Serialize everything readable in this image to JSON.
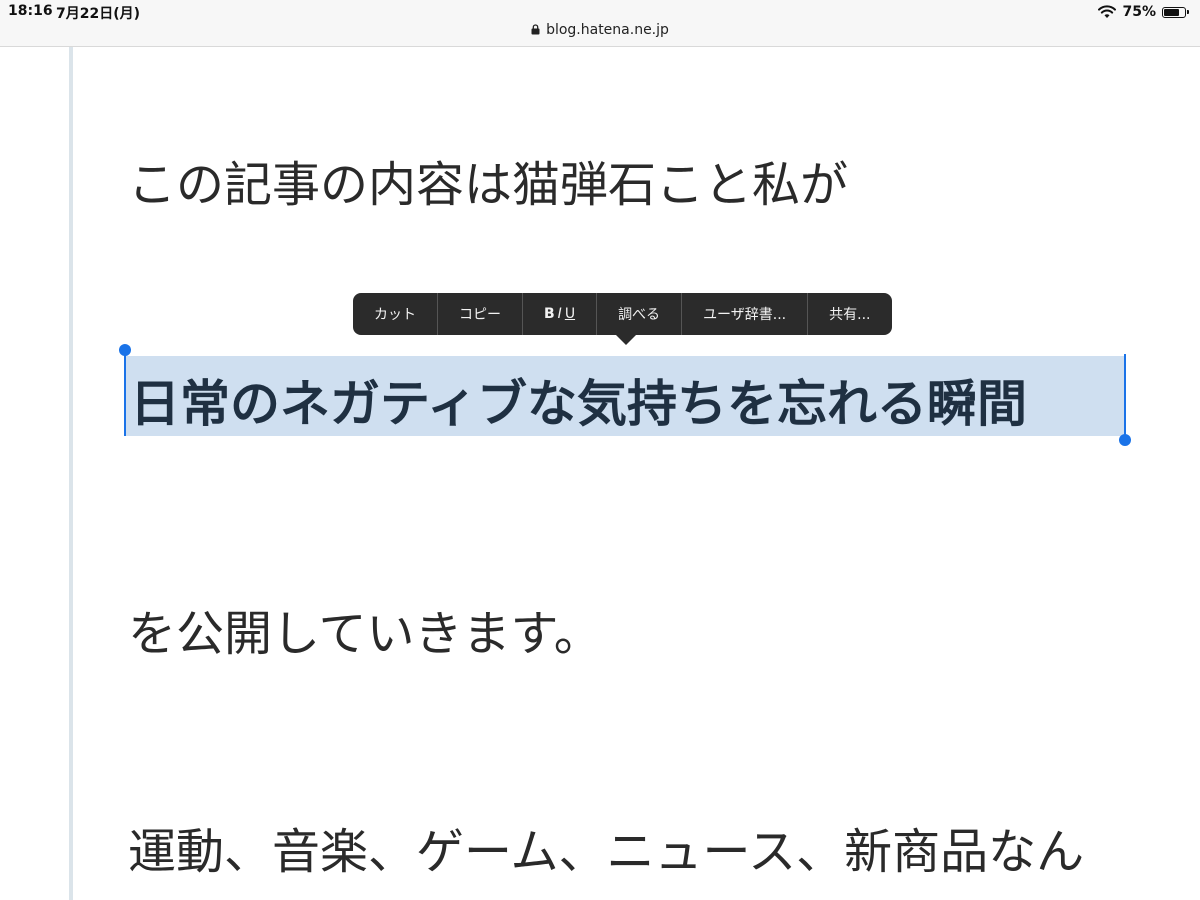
{
  "status_bar": {
    "time": "18:16",
    "date": "7月22日(月)",
    "battery_percent": "75%",
    "battery_level": 0.75,
    "url": "blog.hatena.ne.jp"
  },
  "article": {
    "line1": "この記事の内容は猫弾石こと私が",
    "line2_selected": "日常のネガティブな気持ちを忘れる瞬間",
    "line3": "を公開していきます。",
    "line4": "運動、音楽、ゲーム、ニュース、新商品なん"
  },
  "context_menu": {
    "cut": "カット",
    "copy": "コピー",
    "bold": "B",
    "italic": "I",
    "underline": "U",
    "lookup": "調べる",
    "user_dictionary": "ユーザ辞書...",
    "share": "共有..."
  },
  "colors": {
    "selection_highlight": "#cfdff0",
    "selection_handle": "#1a73e8",
    "menu_background": "#2b2b2b"
  }
}
